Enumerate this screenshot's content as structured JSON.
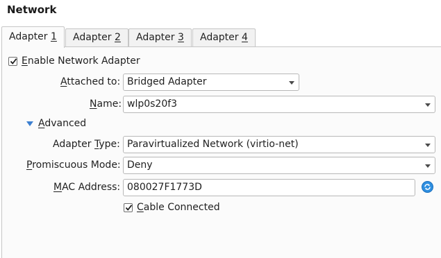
{
  "section": {
    "title": "Network"
  },
  "tabs": [
    {
      "label": "Adapter 1",
      "text": "Adapter ",
      "num": "1",
      "active": true
    },
    {
      "label": "Adapter 2",
      "text": "Adapter ",
      "num": "2",
      "active": false
    },
    {
      "label": "Adapter 3",
      "text": "Adapter ",
      "num": "3",
      "active": false
    },
    {
      "label": "Adapter 4",
      "text": "Adapter ",
      "num": "4",
      "active": false
    }
  ],
  "enable_adapter": {
    "checked": true,
    "pre": "",
    "mn": "E",
    "post": "nable Network Adapter",
    "label": "Enable Network Adapter"
  },
  "attached_to": {
    "label": "Attached to:",
    "pre": "",
    "mn": "A",
    "post": "ttached to:",
    "value": "Bridged Adapter"
  },
  "name": {
    "label": "Name:",
    "pre": "",
    "mn": "N",
    "post": "ame:",
    "value": "wlp0s20f3"
  },
  "advanced": {
    "label": "Advanced",
    "pre": "",
    "mn": "A",
    "post": "dvanced",
    "expanded": true
  },
  "adapter_type": {
    "label": "Adapter Type:",
    "pre": "Adapter ",
    "mn": "T",
    "post": "ype:",
    "value": "Paravirtualized Network (virtio-net)"
  },
  "promiscuous_mode": {
    "label": "Promiscuous Mode:",
    "pre": "",
    "mn": "P",
    "post": "romiscuous Mode:",
    "value": "Deny"
  },
  "mac_address": {
    "label": "MAC Address:",
    "pre": "",
    "mn": "M",
    "post": "AC Address:",
    "value": "080027F1773D"
  },
  "cable_connected": {
    "checked": true,
    "pre": "",
    "mn": "C",
    "post": "able Connected",
    "label": "Cable Connected"
  },
  "icons": {
    "refresh": "refresh-mac-icon",
    "check": "checkmark-icon",
    "dropdown": "chevron-down-icon",
    "disclosure": "disclosure-triangle-icon"
  },
  "colors": {
    "accent": "#2f8fe0",
    "disclosure": "#3c7fd0",
    "border": "#c6c6c6"
  }
}
